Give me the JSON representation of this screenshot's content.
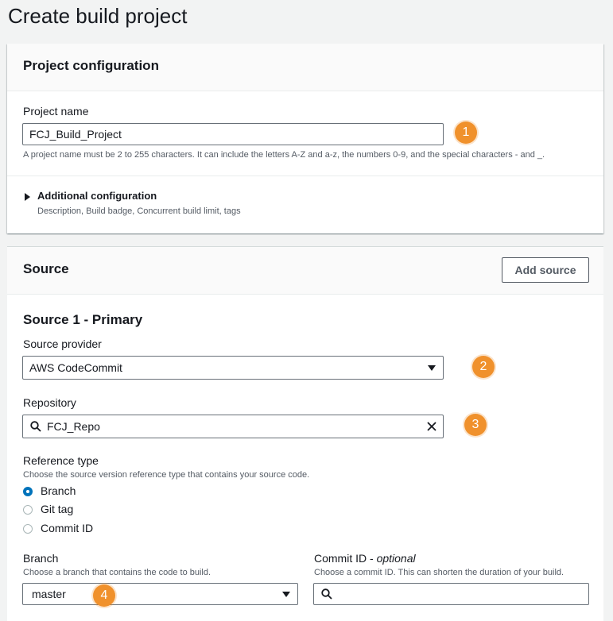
{
  "page": {
    "title": "Create build project"
  },
  "project_config": {
    "heading": "Project configuration",
    "project_name_label": "Project name",
    "project_name_value": "FCJ_Build_Project",
    "project_name_hint": "A project name must be 2 to 255 characters. It can include the letters A-Z and a-z, the numbers 0-9, and the special characters - and _.",
    "additional_label": "Additional configuration",
    "additional_desc": "Description, Build badge, Concurrent build limit, tags"
  },
  "source": {
    "heading": "Source",
    "add_source_label": "Add source",
    "primary_heading": "Source 1 - Primary",
    "provider_label": "Source provider",
    "provider_value": "AWS CodeCommit",
    "repository_label": "Repository",
    "repository_value": "FCJ_Repo",
    "reference_type_label": "Reference type",
    "reference_type_desc": "Choose the source version reference type that contains your source code.",
    "reference_options": [
      "Branch",
      "Git tag",
      "Commit ID"
    ],
    "reference_selected": "Branch",
    "branch_label": "Branch",
    "branch_desc": "Choose a branch that contains the code to build.",
    "branch_value": "master",
    "commit_label": "Commit ID",
    "commit_optional": "optional",
    "commit_separator": " - ",
    "commit_desc": "Choose a commit ID. This can shorten the duration of your build."
  },
  "callouts": [
    "1",
    "2",
    "3",
    "4"
  ],
  "icons": {
    "expand": "caret-right-icon",
    "dropdown": "caret-down-icon",
    "search": "search-icon",
    "clear": "close-icon"
  },
  "colors": {
    "callout": "#f0912c",
    "radio_selected": "#0073bb",
    "page_bg": "#f2f3f3"
  }
}
